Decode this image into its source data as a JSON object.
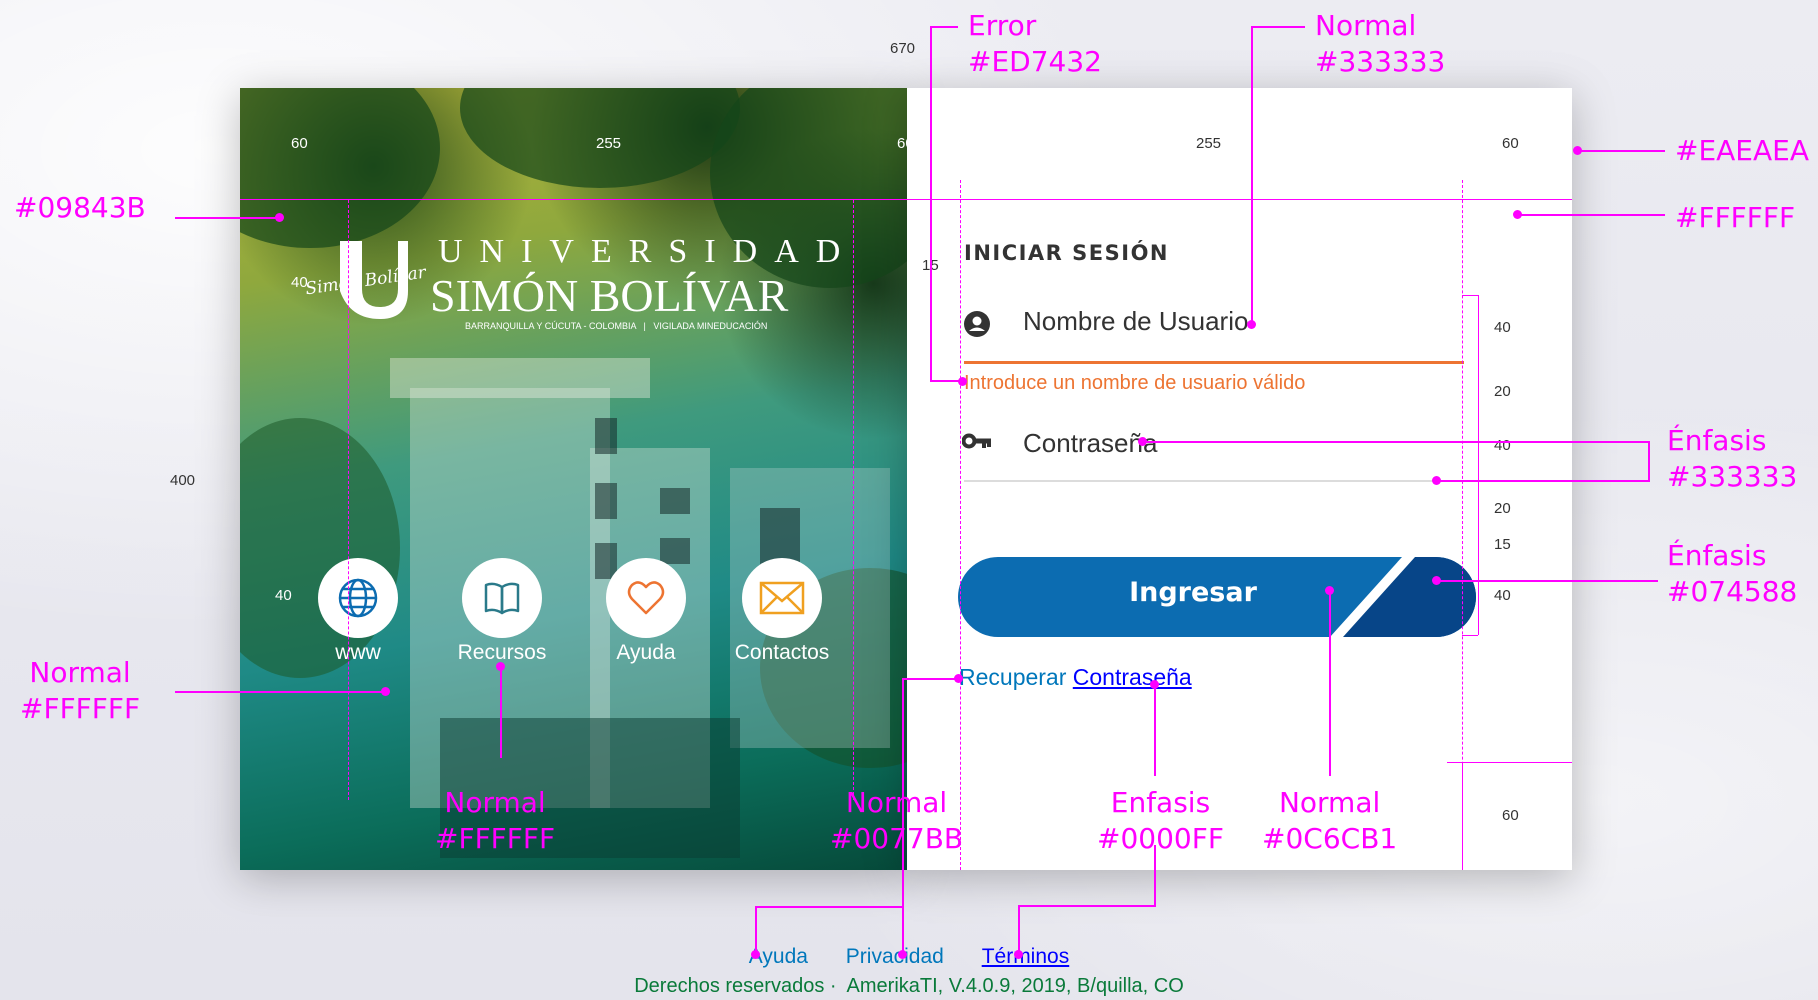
{
  "login": {
    "title": "INICIAR SESIÓN",
    "username_placeholder": "Nombre de Usuario",
    "username_error": "Introduce un nombre de usuario válido",
    "password_placeholder": "Contraseña",
    "submit_label": "Ingresar",
    "recover_prefix": "Recuperar",
    "recover_link": "Contraseña"
  },
  "brand": {
    "line1": "UNIVERSIDAD",
    "line2": "SIMÓN BOLÍVAR",
    "tagline": "BARRANQUILLA Y CÚCUTA - COLOMBIA   |   VIGILADA MINEDUCACIÓN",
    "signature": "Simón Bolívar"
  },
  "quick_links": [
    {
      "label": "www",
      "icon": "globe-icon"
    },
    {
      "label": "Recursos",
      "icon": "book-icon"
    },
    {
      "label": "Ayuda",
      "icon": "heart-icon"
    },
    {
      "label": "Contactos",
      "icon": "mail-icon"
    }
  ],
  "footer": {
    "links": [
      "Ayuda",
      "Privacidad",
      "Términos"
    ],
    "copyright": "Derechos reservados ·  AmerikaTI, V.4.0.9, 2019, B/quilla, CO"
  },
  "annotations": {
    "error": "Error\n#ED7432",
    "normal_input": "Normal\n#333333",
    "eaeaea": "#EAEAEA",
    "ffffff_bg": "#FFFFFF",
    "green": "#09843B",
    "enfasis_input": "Énfasis\n#333333",
    "enfasis_button": "Énfasis\n#074588",
    "normal_white_left": "Normal\n#FFFFFF",
    "normal_white_icons": "Normal\n#FFFFFF",
    "normal_link": "Normal\n#0077BB",
    "enfasis_link": "Enfasis\n#0000FF",
    "normal_button": "Normal\n#0C6CB1"
  },
  "dimensions": {
    "total_width": "670",
    "left_margin_left": "60",
    "left_content": "255",
    "left_margin_right": "60",
    "right_content": "255",
    "right_margin": "60",
    "height": "400",
    "logo_height": "40",
    "icon_height": "40",
    "title_gap": "15",
    "field_user": "40",
    "error_gap": "20",
    "field_pass": "40",
    "pass_gap": "20",
    "btn_gap": "15",
    "btn_height": "40",
    "bottom_margin": "60"
  },
  "colors": {
    "error": "#ED7432",
    "text": "#333333",
    "link": "#0077BB",
    "link_emphasis": "#0000FF",
    "button": "#0C6CB1",
    "button_emphasis": "#074588",
    "green": "#09843B",
    "annotation": "#FF00FF"
  }
}
